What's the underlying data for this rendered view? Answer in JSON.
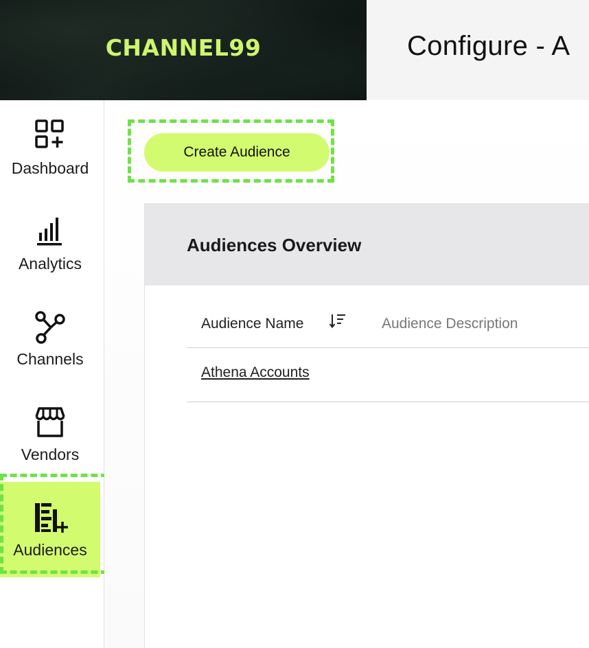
{
  "brand": {
    "logo_text": "CHANNEL99",
    "accent_color": "#cdf56d"
  },
  "header": {
    "page_title": "Configure - A"
  },
  "sidebar": {
    "active_color": "#d3fb70",
    "items": [
      {
        "label": "Dashboard",
        "icon": "dashboard-icon",
        "active": false
      },
      {
        "label": "Analytics",
        "icon": "analytics-icon",
        "active": false
      },
      {
        "label": "Channels",
        "icon": "channels-icon",
        "active": false
      },
      {
        "label": "Vendors",
        "icon": "vendors-icon",
        "active": false
      },
      {
        "label": "Audiences",
        "icon": "audiences-icon",
        "active": true
      }
    ]
  },
  "main": {
    "create_button_label": "Create Audience",
    "highlight_color": "#6ee346",
    "panel_title": "Audiences Overview",
    "table": {
      "columns": [
        "Audience Name",
        "Audience Description"
      ],
      "sort_icon": "sort-descending-icon",
      "rows": [
        {
          "name": "Athena Accounts",
          "description": ""
        }
      ]
    }
  }
}
